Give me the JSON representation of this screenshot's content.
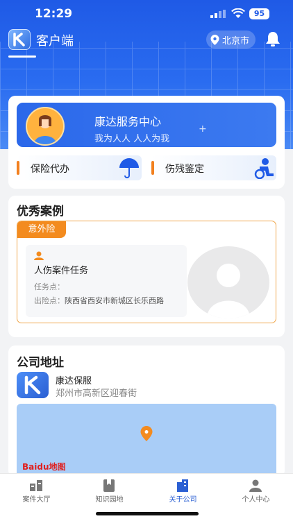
{
  "status_bar": {
    "time": "12:29",
    "battery": "95"
  },
  "header": {
    "app_title": "客户端",
    "location": "北京市"
  },
  "service_banner": {
    "title": "康达服务中心",
    "subtitle": "我为人人 人人为我"
  },
  "services": [
    {
      "label": "保险代办",
      "icon": "umbrella-icon"
    },
    {
      "label": "伤残鉴定",
      "icon": "wheelchair-icon"
    }
  ],
  "cases_section": {
    "title": "优秀案例",
    "case": {
      "tag": "意外险",
      "title": "人伤案件任务",
      "task_point_label": "任务点：",
      "task_point_value": "",
      "accident_point_label": "出险点：",
      "accident_point_value": "陕西省西安市新城区长乐西路"
    }
  },
  "address_section": {
    "title": "公司地址",
    "company_name": "康达保服",
    "company_address": "郑州市高新区迎春街",
    "map_brand": "Baidu地图"
  },
  "tabbar": [
    {
      "label": "案件大厅",
      "icon": "case-hall-icon",
      "active": false
    },
    {
      "label": "知识园地",
      "icon": "knowledge-book-icon",
      "active": false
    },
    {
      "label": "关于公司",
      "icon": "company-building-icon",
      "active": true
    },
    {
      "label": "个人中心",
      "icon": "person-icon",
      "active": false
    }
  ],
  "colors": {
    "primary": "#2a5fd3",
    "accent": "#f38b1f"
  }
}
